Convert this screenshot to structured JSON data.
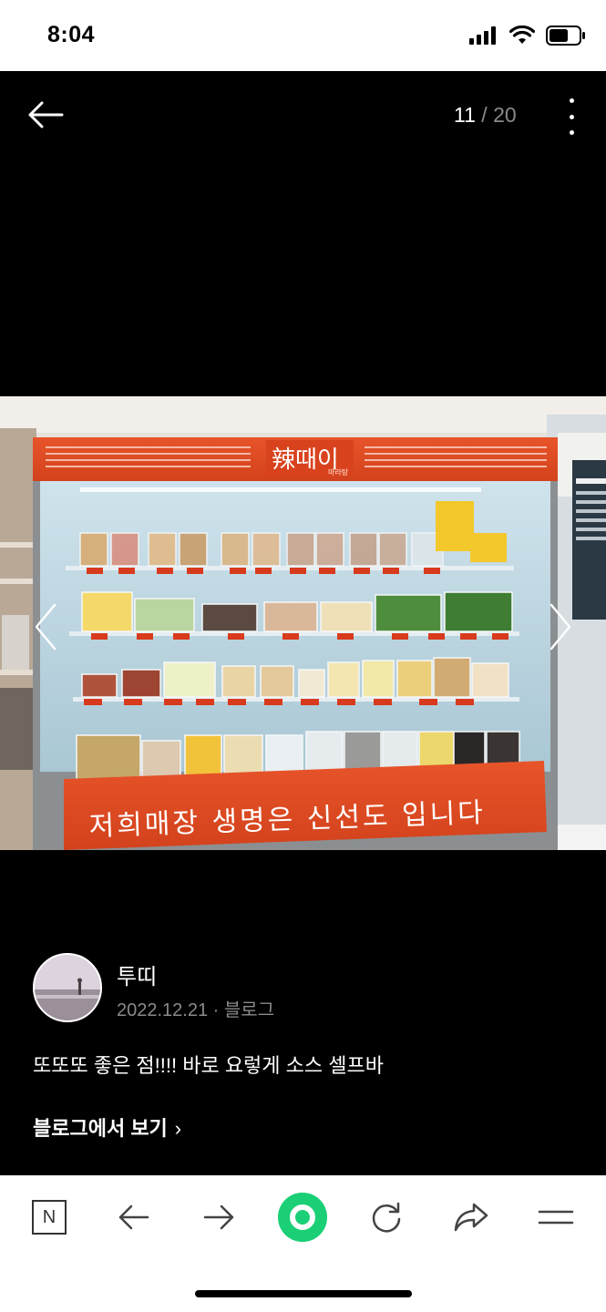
{
  "status_bar": {
    "time": "8:04"
  },
  "viewer": {
    "counter": {
      "current": "11",
      "separator": "/",
      "total": "20"
    }
  },
  "photo": {
    "logo_text": "辣때이",
    "logo_sub": "마라탕",
    "sign_text": "저희매장 생명은 신선도 입니다"
  },
  "post": {
    "author_name": "투띠",
    "date": "2022.12.21",
    "meta_separator": "·",
    "source": "블로그",
    "caption": "또또또 좋은 점!!!! 바로 요렇게 소스 셀프바",
    "link_label": "블로그에서 보기",
    "link_chevron": "›"
  },
  "toolbar": {
    "home_label": "N",
    "items": [
      "naver-home-icon",
      "back-icon",
      "forward-icon",
      "green-dot-icon",
      "refresh-icon",
      "share-icon",
      "menu-icon"
    ],
    "accent": "#19ce60"
  }
}
